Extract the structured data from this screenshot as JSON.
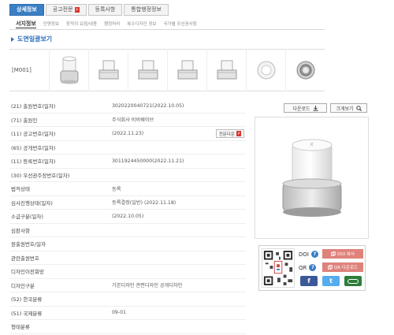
{
  "tabs": [
    {
      "label": "상세정보",
      "active": true
    },
    {
      "label": "공고전문",
      "active": false,
      "has_pdf": true
    },
    {
      "label": "등록사항",
      "active": false
    },
    {
      "label": "통합행정정보",
      "active": false
    }
  ],
  "subtabs": [
    {
      "label": "서지정보",
      "active": true
    },
    {
      "label": "인명정보",
      "active": false
    },
    {
      "label": "창작의 요점/내용",
      "active": false
    },
    {
      "label": "행정처리",
      "active": false
    },
    {
      "label": "복수디자인 정보",
      "active": false
    },
    {
      "label": "국가별 우선권사항",
      "active": false
    }
  ],
  "section_title": "도면일괄보기",
  "model_label": "[M001]",
  "thumbnails_count": 7,
  "fields": [
    {
      "label": "(21) 출원번호(일자)",
      "value": "3020220040721(2022.10.05)"
    },
    {
      "label": "(71) 출원인",
      "value": "주식회사 비비쉐이브"
    },
    {
      "label": "(11) 공고번호(일자)",
      "value": "(2022.11.23)",
      "button": "전문다운"
    },
    {
      "label": "(65) 공개번호(일자)",
      "value": ""
    },
    {
      "label": "(11) 등록번호(일자)",
      "value": "3011924450000(2022.11.21)"
    },
    {
      "label": "(30) 우선권주장번호(일자)",
      "value": ""
    },
    {
      "label": "법적상태",
      "value": "등록"
    },
    {
      "label": "심사진행상태(일자)",
      "value": "등록결정(일반) (2022.11.18)"
    },
    {
      "label": "소급구분(일자)",
      "value": "(2022.10.05)"
    },
    {
      "label": "심판사항",
      "value": ""
    },
    {
      "label": "원출원번호/일자",
      "value": ""
    },
    {
      "label": "관련출원번호",
      "value": ""
    },
    {
      "label": "디자인이전회망",
      "value": ""
    },
    {
      "label": "디자인구분",
      "value": "기본디자인 관련디자인 공개디자인"
    },
    {
      "label": "(52) 한국분류",
      "value": ""
    },
    {
      "label": "(51) 국제분류",
      "value": "09-01"
    },
    {
      "label": "형태분류",
      "value": ""
    }
  ],
  "buttons": {
    "download": "다운로드",
    "zoom": "크게보기"
  },
  "share": {
    "doi_label": "DOI",
    "doi_copy": "DOI 복사",
    "qr_label": "QR",
    "qr_download": "QR 다운로드",
    "help_glyph": "?"
  },
  "colors": {
    "accent": "#3a7fc5",
    "copy_button": "#e0827c",
    "facebook": "#3b5998",
    "twitter": "#55acee",
    "band": "#2f7d3a"
  },
  "icons": {
    "facebook": "facebook-icon",
    "twitter": "twitter-icon",
    "band": "band-icon",
    "download": "download-icon",
    "zoom": "magnifier-icon",
    "pdf": "pdf-icon"
  }
}
